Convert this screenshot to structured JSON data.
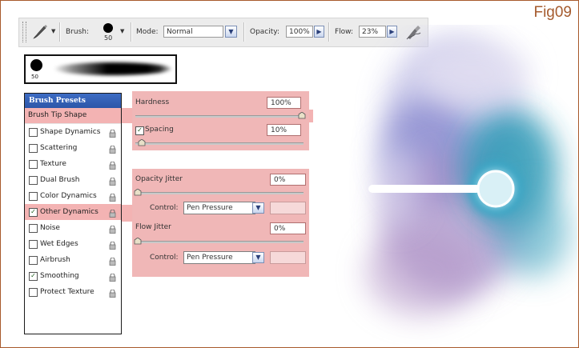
{
  "figure_label": "Fig09",
  "options_bar": {
    "brush_label": "Brush:",
    "brush_size": "50",
    "mode_label": "Mode:",
    "mode_value": "Normal",
    "opacity_label": "Opacity:",
    "opacity_value": "100%",
    "flow_label": "Flow:",
    "flow_value": "23%"
  },
  "brush_preview": {
    "size": "50"
  },
  "brush_panel": {
    "header": "Brush Presets",
    "tip_shape": "Brush Tip Shape",
    "items": [
      {
        "label": "Shape Dynamics",
        "checked": false
      },
      {
        "label": "Scattering",
        "checked": false
      },
      {
        "label": "Texture",
        "checked": false
      },
      {
        "label": "Dual Brush",
        "checked": false
      },
      {
        "label": "Color Dynamics",
        "checked": false
      },
      {
        "label": "Other Dynamics",
        "checked": true
      },
      {
        "label": "Noise",
        "checked": false
      },
      {
        "label": "Wet Edges",
        "checked": false
      },
      {
        "label": "Airbrush",
        "checked": false
      },
      {
        "label": "Smoothing",
        "checked": true
      },
      {
        "label": "Protect Texture",
        "checked": false
      }
    ]
  },
  "tip_settings": {
    "hardness_label": "Hardness",
    "hardness_value": "100%",
    "spacing_label": "Spacing",
    "spacing_value": "10%",
    "spacing_checked": true
  },
  "other_dynamics": {
    "opacity_jitter_label": "Opacity Jitter",
    "opacity_jitter_value": "0%",
    "control_label": "Control:",
    "opacity_control": "Pen Pressure",
    "flow_jitter_label": "Flow Jitter",
    "flow_jitter_value": "0%",
    "flow_control": "Pen Pressure"
  },
  "colors": {
    "highlight": "#f3b3b3",
    "panel_header": "#2c56a8",
    "frame": "#a85a2c",
    "teal": "#2fa6c0",
    "purple": "#8b7cc4"
  }
}
